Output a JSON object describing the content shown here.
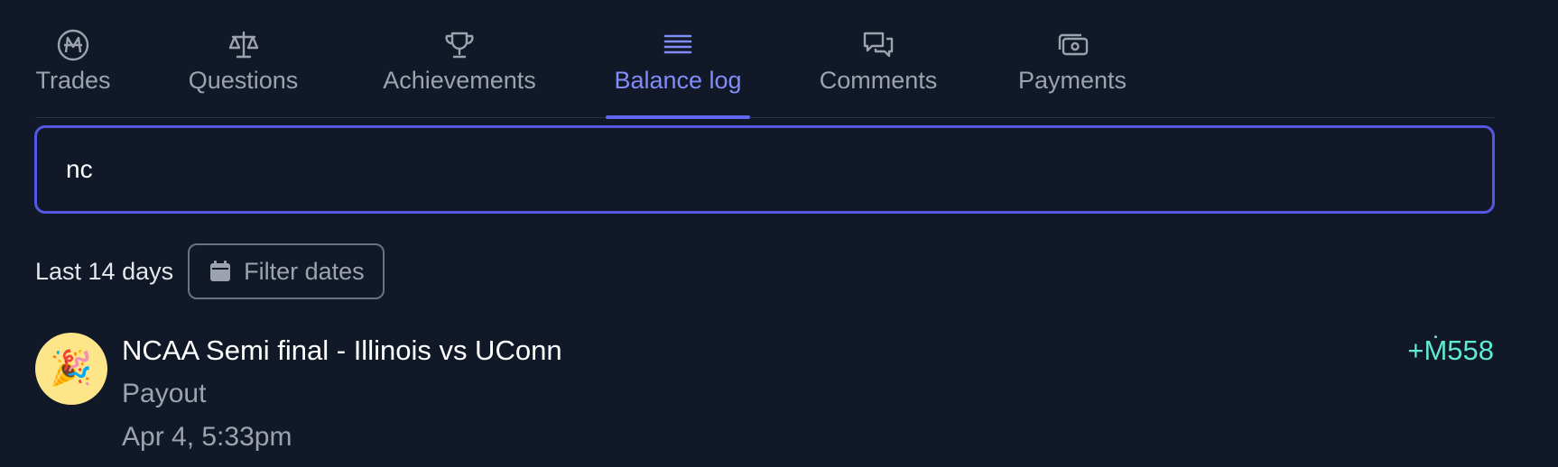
{
  "tabs": [
    {
      "label": "Trades",
      "icon": "mana-coin-icon"
    },
    {
      "label": "Questions",
      "icon": "scale-icon"
    },
    {
      "label": "Achievements",
      "icon": "trophy-icon"
    },
    {
      "label": "Balance log",
      "icon": "list-icon",
      "active": true
    },
    {
      "label": "Comments",
      "icon": "chat-bubbles-icon"
    },
    {
      "label": "Payments",
      "icon": "cash-icon"
    }
  ],
  "search": {
    "value": "nc"
  },
  "filter": {
    "range_label": "Last 14 days",
    "button_label": "Filter dates",
    "icon": "calendar-icon"
  },
  "entries": [
    {
      "avatar": "🎉",
      "title": "NCAA Semi final - Illinois vs UConn",
      "type": "Payout",
      "date": "Apr 4, 5:33pm",
      "amount": "+Ṁ558"
    }
  ],
  "colors": {
    "background": "#111827",
    "accent": "#6366f1",
    "positive_amount": "#5eead4",
    "avatar_bg": "#fde68a"
  }
}
